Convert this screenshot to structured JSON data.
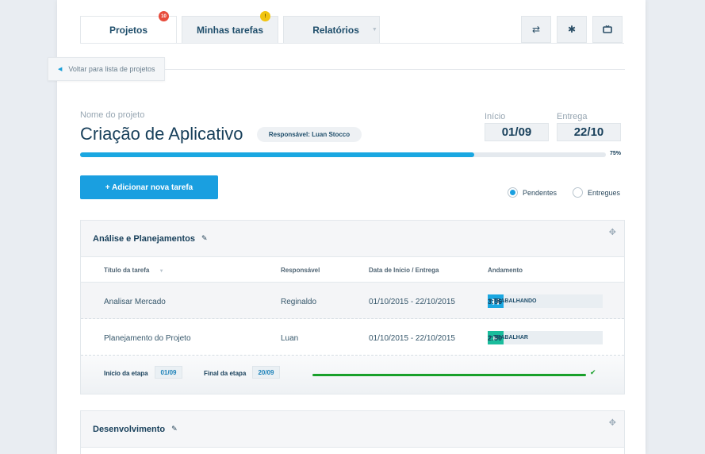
{
  "tabs": [
    {
      "label": "Projetos",
      "badge": "10",
      "badge_color": "#e74c3c"
    },
    {
      "label": "Minhas tarefas",
      "badge": "!",
      "badge_color": "#f1c40f"
    },
    {
      "label": "Relatórios"
    }
  ],
  "toolbar": {
    "refresh_icon": "refresh-icon",
    "settings_icon": "gear-icon",
    "tv_icon": "tv-icon"
  },
  "back": {
    "label": "Voltar para lista de projetos"
  },
  "project": {
    "name_label": "Nome do projeto",
    "name": "Criação de Aplicativo",
    "responsible": "Responsável: Luan Stocco",
    "start_label": "Início",
    "start": "01/09",
    "end_label": "Entrega",
    "end": "22/10",
    "progress": 0.75,
    "progress_text": "75%"
  },
  "add_task": {
    "label": "+ Adicionar nova tarefa"
  },
  "filters": {
    "pending": "Pendentes",
    "delivered": "Entregues",
    "selected": "pending"
  },
  "columns": {
    "title": "Título da tarefa",
    "responsible": "Responsável",
    "dates": "Data de Início / Entrega",
    "progress": "Andamento"
  },
  "stages": [
    {
      "name": "Análise e Planejamentos",
      "tasks": [
        {
          "title": "Analisar Mercado",
          "responsible": "Reginaldo",
          "dates": "01/10/2015 - 22/10/2015",
          "status": "TRABALHANDO",
          "time": "3:56",
          "state": "pause",
          "btn_color": "#1aa7e1"
        },
        {
          "title": "Planejamento do Projeto",
          "responsible": "Luan",
          "dates": "01/10/2015 - 22/10/2015",
          "status": "TRABALHAR",
          "time": "2:30",
          "state": "play",
          "btn_color": "#1abc9c"
        }
      ],
      "start_label": "Início da etapa",
      "start": "01/09",
      "end_label": "Final da etapa",
      "end": "20/09"
    },
    {
      "name": "Desenvolvimento"
    }
  ]
}
